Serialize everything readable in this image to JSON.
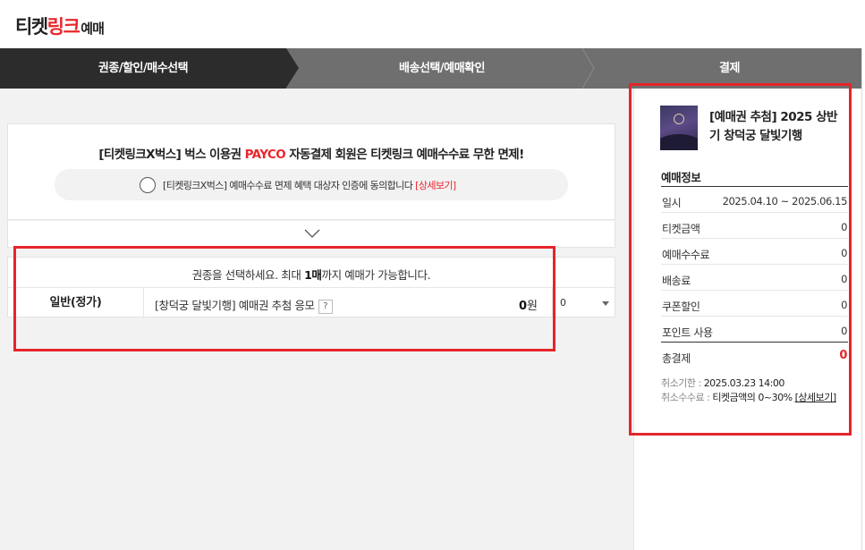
{
  "logo": {
    "part1": "티켓",
    "part2": "링크",
    "part3": "예매"
  },
  "steps": [
    {
      "label": "권종/할인/매수선택",
      "active": true
    },
    {
      "label": "배송선택/예매확인",
      "active": false
    },
    {
      "label": "결제",
      "active": false
    }
  ],
  "promo": {
    "prefix": "[티켓링크X벅스] 벅스 이용권 ",
    "highlight": "PAYCO",
    "suffix": " 자동결제 회원은 티켓링크 예매수수료 무한 면제!",
    "agree_text": "[티켓링크X벅스] 예매수수료 면제 혜택 대상자 인증에 동의합니다 ",
    "agree_link": "[상세보기]"
  },
  "ticket": {
    "notice_prefix": "권종을 선택하세요. 최대 ",
    "notice_bold": "1매",
    "notice_suffix": "까지 예매가 가능합니다.",
    "type": "일반(정가)",
    "name": "[창덕궁 달빛기행] 예매권 추첨 응모",
    "help": "?",
    "price_value": "0",
    "price_unit": "원",
    "quantity": "0"
  },
  "sidebar": {
    "title": "[예매권 추첨] 2025 상반기 창덕궁 달빛기행",
    "info_heading": "예매정보",
    "rows": [
      {
        "label": "일시",
        "value": "2025.04.10 ~ 2025.06.15"
      },
      {
        "label": "티켓금액",
        "value": "0"
      },
      {
        "label": "예매수수료",
        "value": "0"
      },
      {
        "label": "배송료",
        "value": "0"
      },
      {
        "label": "쿠폰할인",
        "value": "0"
      },
      {
        "label": "포인트 사용",
        "value": "0"
      }
    ],
    "total_label": "총결제",
    "total_value": "0",
    "cancel_deadline_label": "취소기한 : ",
    "cancel_deadline_value": "2025.03.23 14:00",
    "cancel_fee_label": "취소수수료 : ",
    "cancel_fee_value": "티켓금액의 0~30% ",
    "cancel_fee_link": "[상세보기]"
  },
  "colors": {
    "accent": "#e8262d",
    "step_active": "#2c2c2c",
    "step_inactive": "#6f6f6f",
    "highlight_box": "#e5252a"
  }
}
